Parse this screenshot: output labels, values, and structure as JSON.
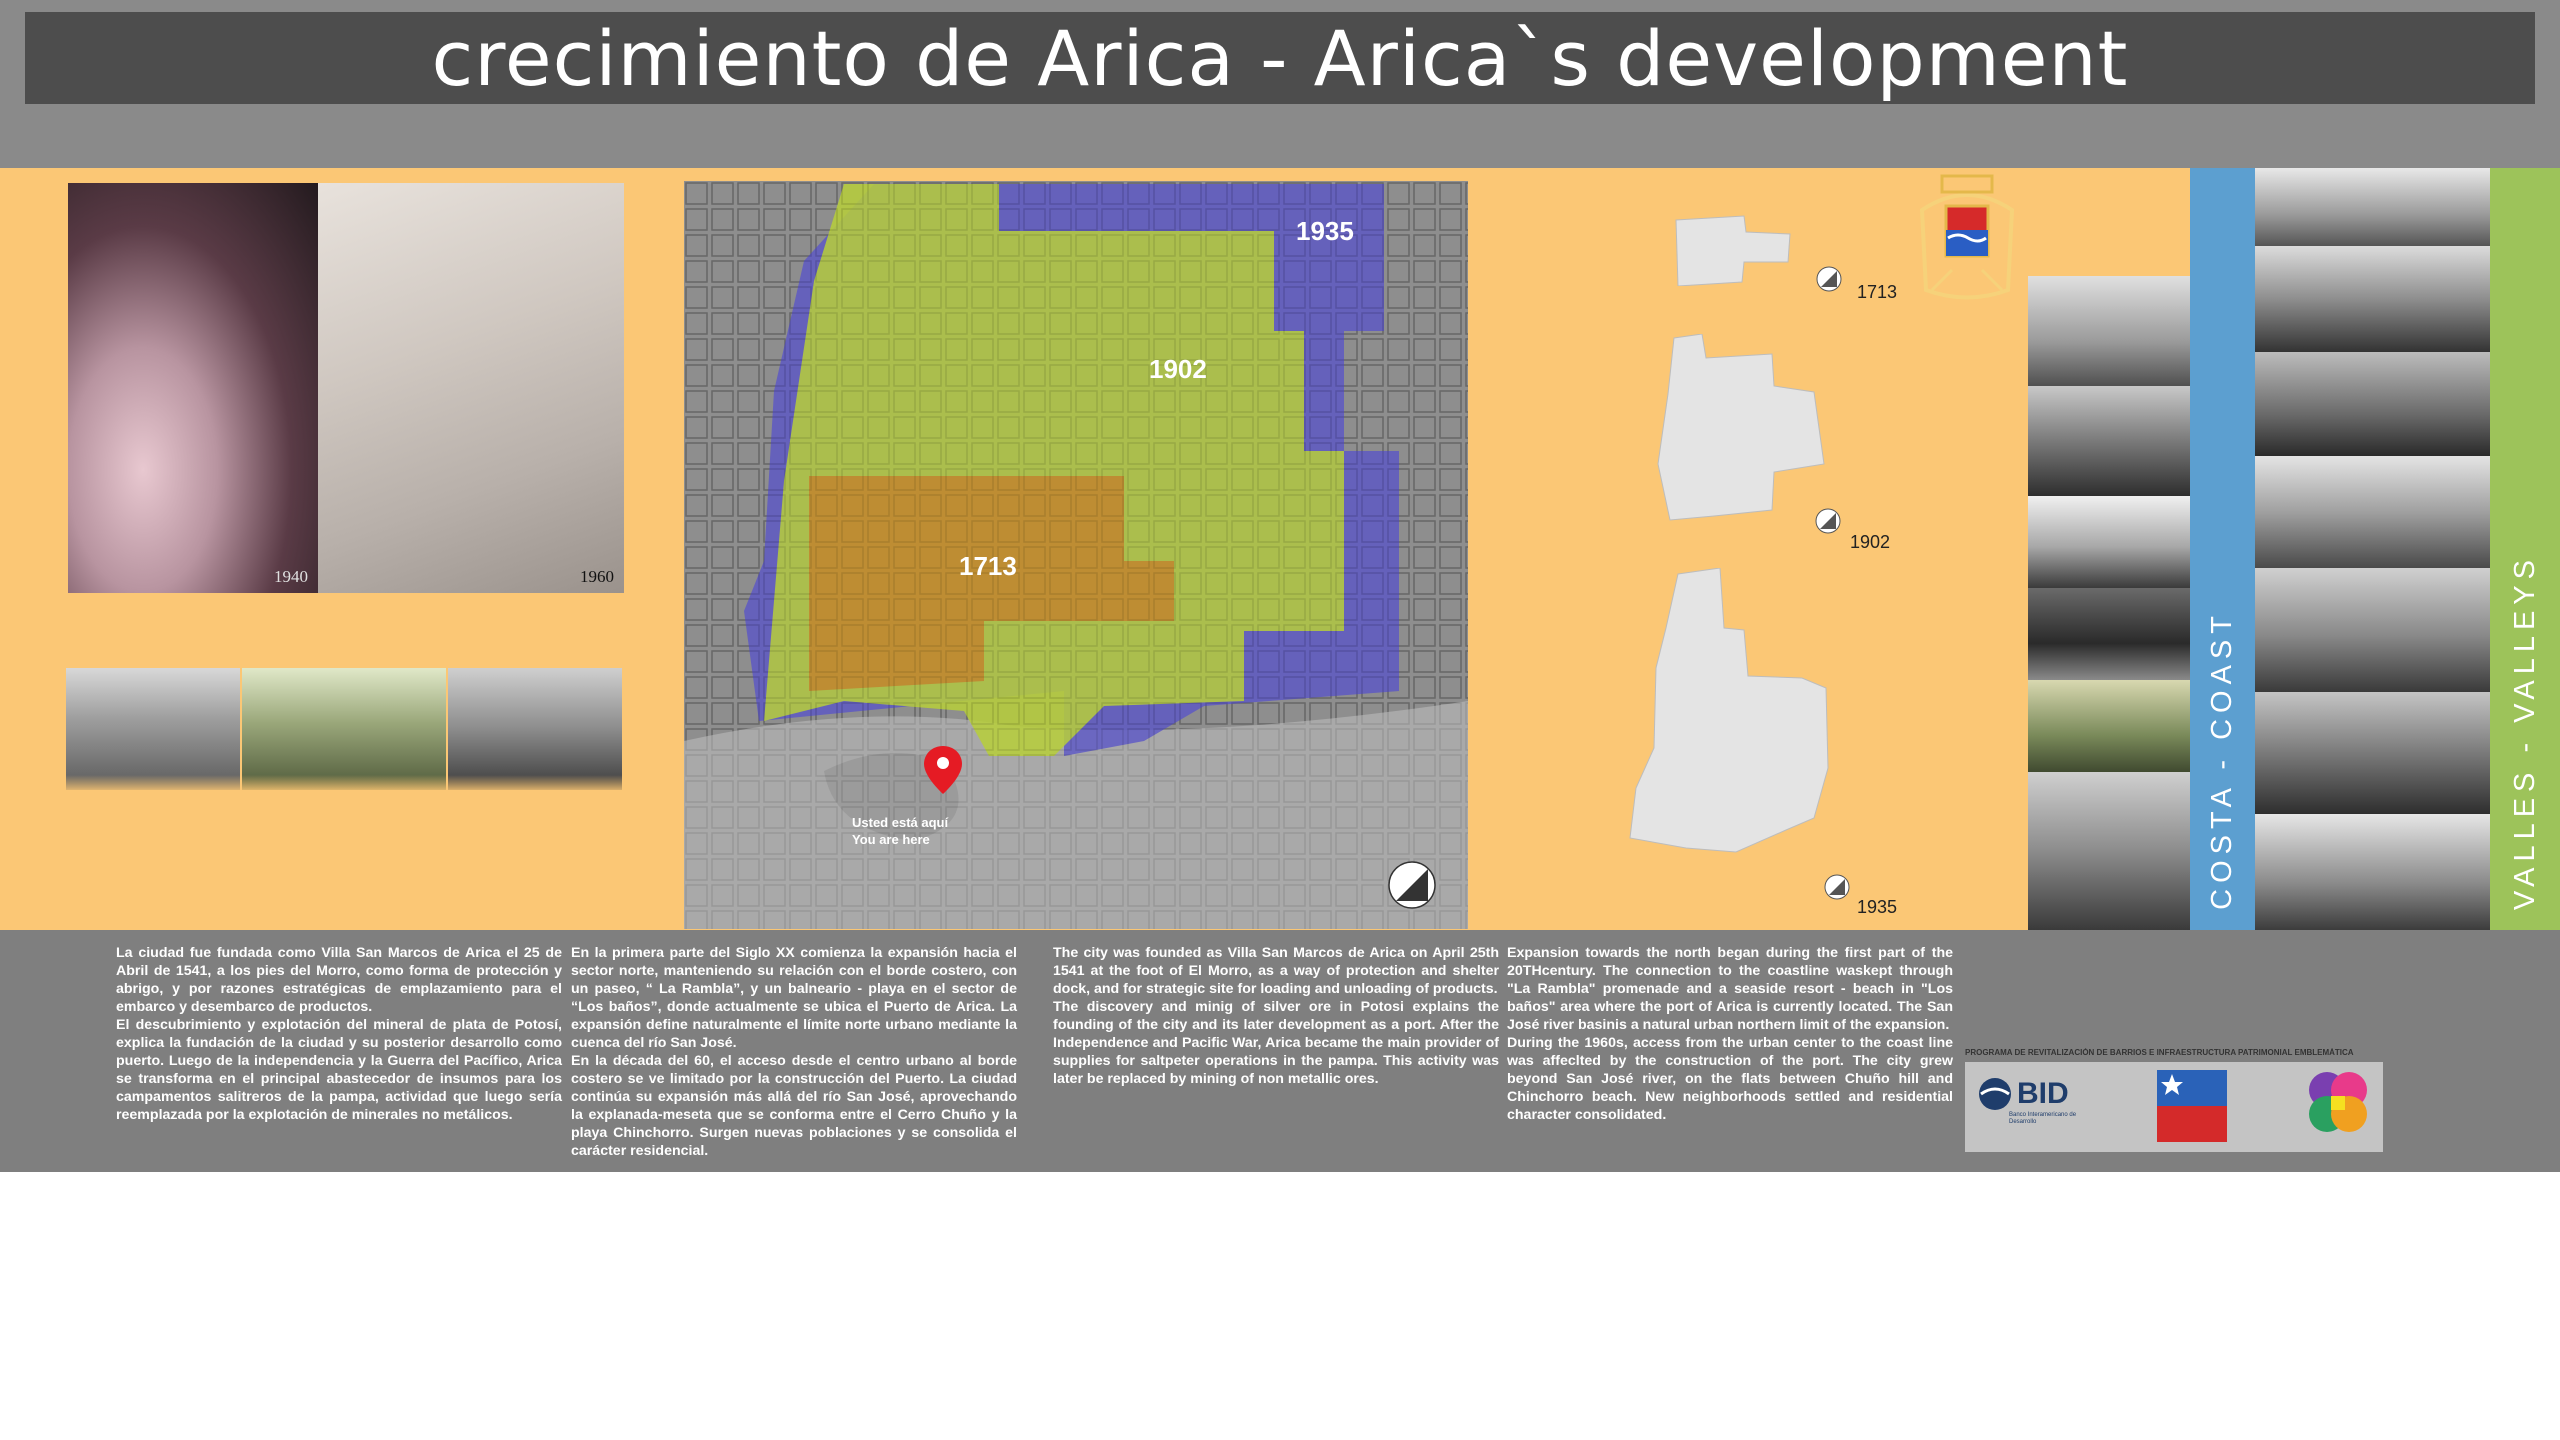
{
  "title": "crecimiento de Arica - Arica`s development",
  "aerial_photos": {
    "left_year": "1940",
    "right_year": "1960"
  },
  "map": {
    "zones": [
      {
        "label": "1935",
        "color": "#5a55c8"
      },
      {
        "label": "1902",
        "color": "#b7cf3a"
      },
      {
        "label": "1713",
        "color": "#c08630"
      }
    ],
    "marker_text_es": "Usted está aquí",
    "marker_text_en": "You are here"
  },
  "silhouettes": [
    {
      "year": "1713"
    },
    {
      "year": "1902"
    },
    {
      "year": "1935"
    }
  ],
  "side_labels": {
    "costa": "COSTA - COAST",
    "valles": "VALLES - VALLEYS"
  },
  "colors": {
    "accent_blue": "#5c9fd0",
    "accent_green": "#9dc35a",
    "panel_orange": "#fbc775"
  },
  "text": {
    "es_col1": [
      "La ciudad fue fundada como Villa San Marcos de Arica el 25 de Abril de 1541, a los pies del Morro, como forma de protección y abrigo, y por razones estratégicas de emplazamiento para el embarco y desembarco de productos.",
      "El descubrimiento y explotación del mineral de plata de Potosí, explica la fundación de la ciudad y su posterior desarrollo como puerto. Luego de la independencia y la Guerra del Pacífico, Arica se transforma en el principal abastecedor de insumos para los campamentos salitreros de la pampa, actividad que luego sería reemplazada por la explotación de minerales no metálicos."
    ],
    "es_col2": [
      "En la primera parte del Siglo XX comienza la expansión hacia el sector norte, manteniendo su relación con el borde costero, con un paseo, “ La Rambla”, y un balneario - playa en el sector de “Los baños”, donde actualmente se ubica el Puerto de Arica. La expansión define naturalmente el límite norte urbano mediante la cuenca del río San José.",
      "En la década del 60, el acceso desde el centro urbano al borde costero se ve limitado por la construcción del Puerto. La ciudad continúa su expansión más allá del río San José, aprovechando la explanada-meseta que se conforma entre el Cerro Chuño y la playa Chinchorro. Surgen nuevas poblaciones y se consolida el carácter residencial."
    ],
    "en_col1": [
      "The city was founded as Villa San Marcos de Arica on April 25th 1541 at the foot of El Morro, as a way of protection and shelter dock, and for strategic site for loading and unloading of products.",
      "The discovery and minig of silver ore in Potosi explains the founding of the city and its later development as a port. After the Independence and Pacific War, Arica became the main provider of supplies for saltpeter operations in the pampa. This activity was later be replaced by mining of non metallic ores."
    ],
    "en_col2": [
      "Expansion towards the north began during the first part of the 20THcentury. The connection to the coastline waskept through \"La Rambla\" promenade and a seaside resort - beach in \"Los baños\" area where the port of Arica is currently located. The San José river basinis a natural urban northern limit of the expansion.",
      "During the 1960s, access from the urban center to the coast line was affeclted by the construction of the port. The city grew beyond San José river, on the flats between Chuño hill and Chinchorro beach. New neighborhoods settled and residential character consolidated."
    ]
  },
  "sponsors": {
    "caption": "PROGRAMA DE REVITALIZACIÓN DE BARRIOS E INFRAESTRUCTURA PATRIMONIAL EMBLEMÁTICA",
    "bid_label": "BID",
    "bid_sub": "Banco Interamericano de Desarrollo"
  }
}
